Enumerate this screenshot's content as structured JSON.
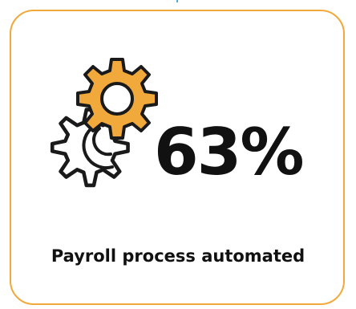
{
  "stat": {
    "value": "63%",
    "caption": "Payroll process automated"
  },
  "icons": {
    "gears": "gears-icon"
  },
  "colors": {
    "card_border": "#f2a93b",
    "gear_fill": "#f2a93b",
    "gear_outline": "#1a1a1a",
    "text": "#111111",
    "top_mark": "#1e8bd4"
  }
}
